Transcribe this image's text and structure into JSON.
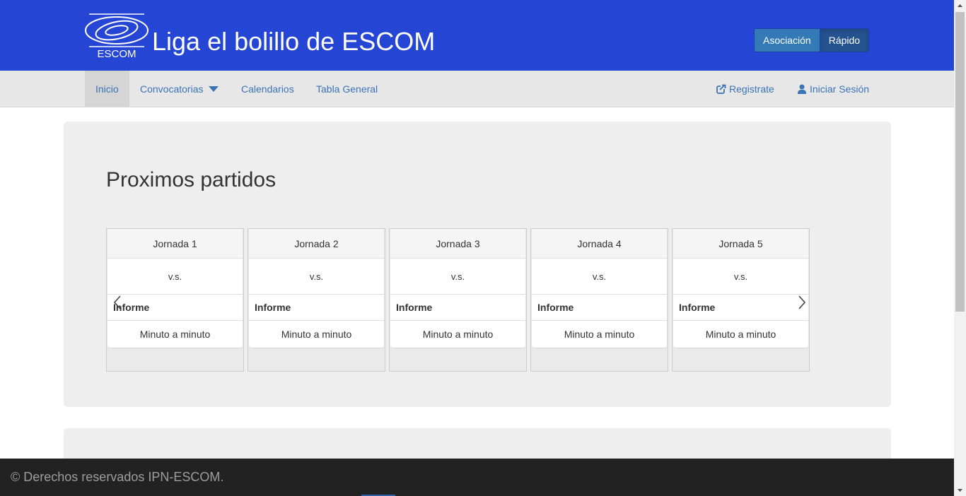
{
  "header": {
    "logo_text": "ESCOM",
    "title": "Liga el bolillo de ESCOM",
    "buttons": {
      "asociacion": "Asociación",
      "rapido": "Rápido"
    }
  },
  "nav": {
    "inicio": "Inicio",
    "convocatorias": "Convocatorias",
    "calendarios": "Calendarios",
    "tabla_general": "Tabla General",
    "registrate": "Registrate",
    "iniciar_sesion": "Iniciar Sesión"
  },
  "main": {
    "title": "Proximos partidos",
    "matches": [
      {
        "jornada": "Jornada 1",
        "vs": "v.s.",
        "informe": "Informe",
        "action": "Minuto a minuto"
      },
      {
        "jornada": "Jornada 2",
        "vs": "v.s.",
        "informe": "Informe",
        "action": "Minuto a minuto"
      },
      {
        "jornada": "Jornada 3",
        "vs": "v.s.",
        "informe": "Informe",
        "action": "Minuto a minuto"
      },
      {
        "jornada": "Jornada 4",
        "vs": "v.s.",
        "informe": "Informe",
        "action": "Minuto a minuto"
      },
      {
        "jornada": "Jornada 5",
        "vs": "v.s.",
        "informe": "Informe",
        "action": "Minuto a minuto"
      }
    ]
  },
  "footer": {
    "text": "© Derechos reservados IPN-ESCOM."
  },
  "colors": {
    "header_bg": "#2545d5",
    "navbar_bg": "#e7e7e7",
    "link": "#3a73b6",
    "footer_bg": "#222222"
  },
  "icons": {
    "logo": "escom-logo",
    "registrate": "share-square-icon",
    "iniciar_sesion": "user-icon",
    "prev": "chevron-left-icon",
    "next": "chevron-right-icon"
  }
}
